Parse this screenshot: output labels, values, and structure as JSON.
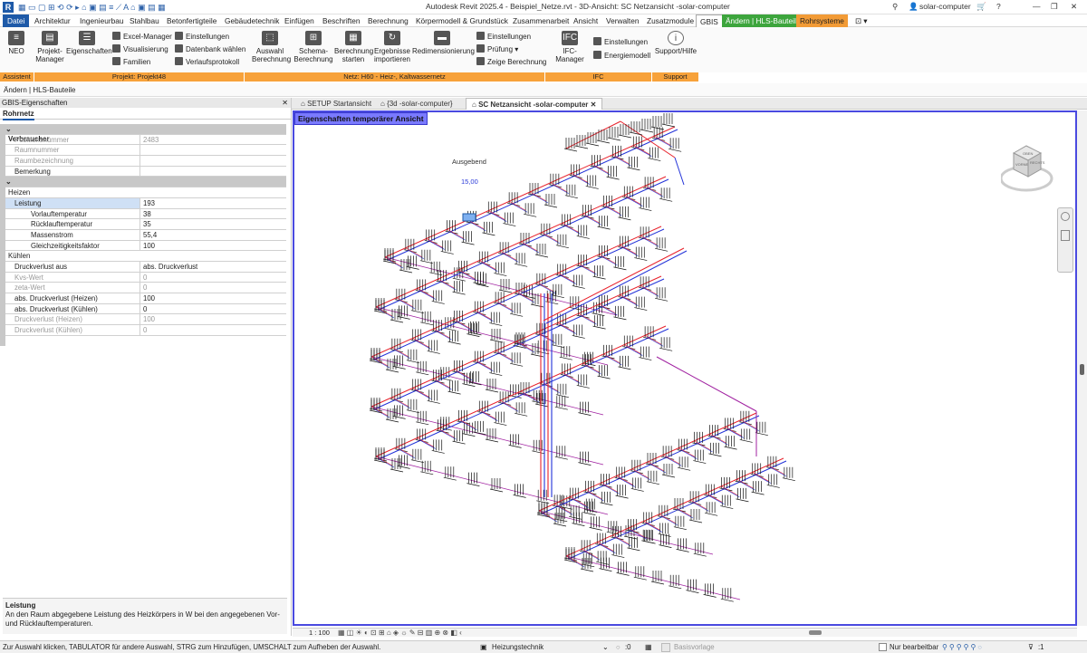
{
  "window": {
    "title": "Autodesk Revit 2025.4 - Beispiel_Netze.rvt - 3D-Ansicht: SC Netzansicht -solar-computer",
    "user": "solar-computer",
    "help": "?"
  },
  "menu": {
    "tabs": [
      "Datei",
      "Architektur",
      "Ingenieurbau",
      "Stahlbau",
      "Betonfertigteile",
      "Gebäudetechnik",
      "Einfügen",
      "Beschriften",
      "Berechnung",
      "Körpermodell & Grundstück",
      "Zusammenarbeit",
      "Ansicht",
      "Verwalten",
      "Zusatzmodule",
      "GBIS",
      "Ändern | HLS-Bauteile",
      "Rohrsysteme"
    ]
  },
  "ribbon": {
    "neo": "NEO",
    "projektmanager": "Projekt-\nManager",
    "eigenschaften": "Eigenschaften",
    "excel": "Excel-Manager",
    "visualisierung": "Visualisierung",
    "familien": "Familien",
    "einstellungen1": "Einstellungen",
    "datenbank": "Datenbank wählen",
    "verlauf": "Verlaufsprotokoll",
    "auswahl": "Auswahl\nBerechnung",
    "schema": "Schema-\nBerechnung",
    "berechnung_starten": "Berechnung\nstarten",
    "ergebnisse": "Ergebnisse\nimportieren",
    "redim": "Redimensionierung",
    "einstellungen2": "Einstellungen",
    "pruefung": "Prüfung",
    "zeige": "Zeige Berechnung",
    "ifcmanager": "IFC-Manager",
    "einstellungen3": "Einstellungen",
    "energiemodell": "Energiemodell",
    "support": "Support/Hilfe",
    "panels": [
      "Assistent",
      "Projekt: Projekt48",
      "Netz: H60 - Heiz-, Kaltwassernetz",
      "IFC",
      "Support"
    ]
  },
  "optionsbar": {
    "label": "Ändern | HLS-Bauteile"
  },
  "properties": {
    "title": "GBIS-Eigenschaften",
    "tab": "Rohrnetz",
    "rows": [
      {
        "name": "Verbraucher",
        "value": "",
        "type": "sec"
      },
      {
        "name": "Positionsnummer",
        "value": "2483",
        "type": "dim"
      },
      {
        "name": "Raumnummer",
        "value": "",
        "type": "dim"
      },
      {
        "name": "Raumbezeichnung",
        "value": "",
        "type": "dim"
      },
      {
        "name": "Bemerkung",
        "value": "",
        "type": "norm"
      },
      {
        "name": "Daten und Ergebnisse",
        "value": "",
        "type": "sec"
      },
      {
        "name": "Heizen",
        "value": "",
        "type": "grp"
      },
      {
        "name": "Leistung",
        "value": "193",
        "type": "sel"
      },
      {
        "name": "Vorlauftemperatur",
        "value": "38",
        "type": "ind"
      },
      {
        "name": "Rücklauftemperatur",
        "value": "35",
        "type": "ind"
      },
      {
        "name": "Massenstrom",
        "value": "55,4",
        "type": "ind"
      },
      {
        "name": "Gleichzeitigkeitsfaktor",
        "value": "100",
        "type": "ind"
      },
      {
        "name": "Kühlen",
        "value": "",
        "type": "grp"
      },
      {
        "name": "Druckverlust aus",
        "value": "abs. Druckverlust",
        "type": "norm"
      },
      {
        "name": "Kvs-Wert",
        "value": "0",
        "type": "dim"
      },
      {
        "name": "zeta-Wert",
        "value": "0",
        "type": "dim"
      },
      {
        "name": "abs. Druckverlust (Heizen)",
        "value": "100",
        "type": "norm"
      },
      {
        "name": "abs. Druckverlust (Kühlen)",
        "value": "0",
        "type": "norm"
      },
      {
        "name": "Druckverlust (Heizen)",
        "value": "100",
        "type": "dim"
      },
      {
        "name": "Druckverlust (Kühlen)",
        "value": "0",
        "type": "dim"
      }
    ],
    "help_title": "Leistung",
    "help_text": "An den Raum abgegebene Leistung des Heizkörpers in W bei den angegebenen Vor- und Rücklauftemperaturen."
  },
  "doctabs": [
    "SETUP Startansicht",
    "{3d -solar-computer}",
    "SC Netzansicht -solar-computer"
  ],
  "view": {
    "label": "Eigenschaften temporärer Ansicht",
    "annotation": "Ausgebend",
    "annotation2": "15,00",
    "scale": "1 : 100",
    "cube_top": "OBEN",
    "cube_front": "VORNE",
    "cube_right": "RECHTS"
  },
  "status": {
    "hint": "Zur Auswahl klicken, TABULATOR für andere Auswahl, STRG zum Hinzufügen, UMSCHALT zum Aufheben der Auswahl.",
    "system": "Heizungstechnik",
    "count": ":0",
    "basis": "Basisvorlage",
    "nur": "Nur bearbeitbar",
    "filter": ":1"
  },
  "colors": {
    "accent": "#1e5aa8",
    "orange": "#f29b36",
    "green": "#3da53d",
    "view_border": "#4a4ae0",
    "pipe_supply": "#e8202a",
    "pipe_return": "#2232d8",
    "pipe_other": "#a020a0"
  }
}
